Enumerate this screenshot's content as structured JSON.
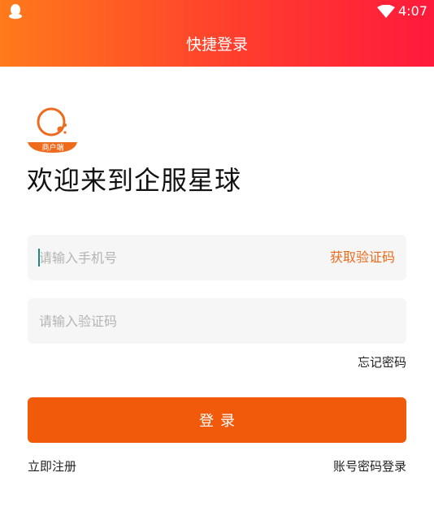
{
  "status_bar": {
    "time": "4:07",
    "left_icon": "qq-penguin-icon",
    "right_icon": "wifi-icon"
  },
  "header": {
    "title": "快捷登录",
    "gradient_start": "#ff7a1a",
    "gradient_end": "#ff1a3c"
  },
  "logo": {
    "badge_text": "商户端",
    "icon": "planet-logo-icon",
    "color": "#ee6a1c"
  },
  "welcome_text": "欢迎来到企服星球",
  "phone_field": {
    "placeholder": "请输入手机号",
    "value": "",
    "action_label": "获取验证码"
  },
  "code_field": {
    "placeholder": "请输入验证码",
    "value": ""
  },
  "forgot_password": "忘记密码",
  "login_button": {
    "label": "登录",
    "color": "#f05a0a"
  },
  "footer": {
    "register_label": "立即注册",
    "password_login_label": "账号密码登录"
  }
}
